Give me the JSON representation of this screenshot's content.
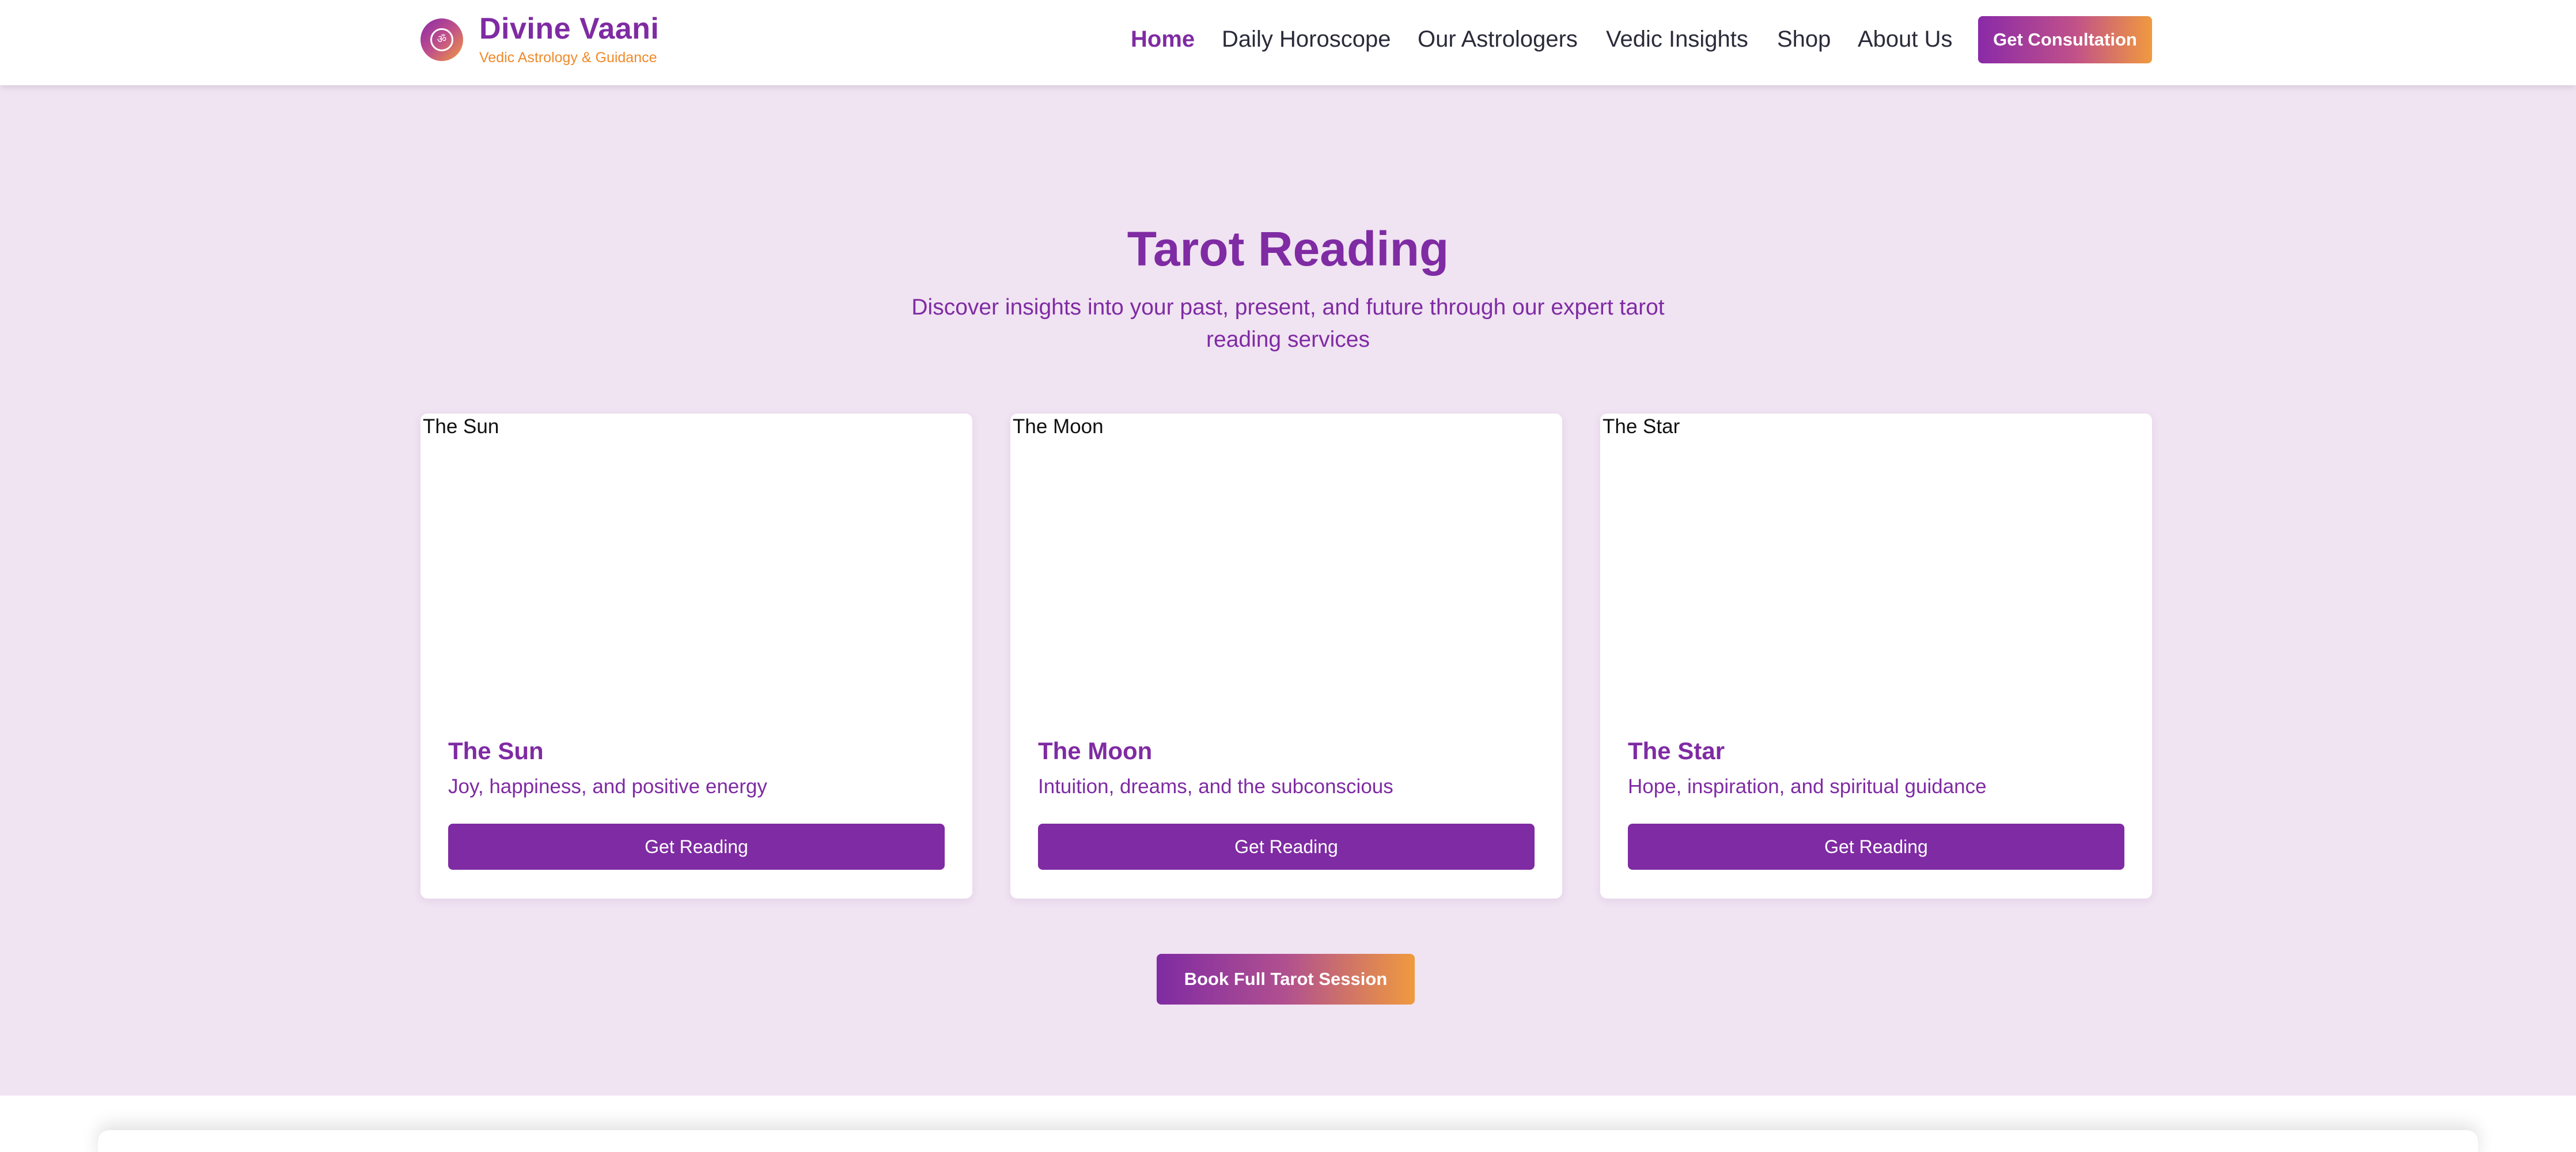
{
  "header": {
    "brand_name": "Divine Vaani",
    "brand_tagline": "Vedic Astrology & Guidance",
    "logo_symbol": "ॐ",
    "logo_icon": "om-icon",
    "nav": [
      {
        "label": "Home",
        "active": true
      },
      {
        "label": "Daily Horoscope",
        "active": false
      },
      {
        "label": "Our Astrologers",
        "active": false
      },
      {
        "label": "Vedic Insights",
        "active": false
      },
      {
        "label": "Shop",
        "active": false
      },
      {
        "label": "About Us",
        "active": false
      }
    ],
    "cta_label": "Get Consultation"
  },
  "tarot": {
    "title": "Tarot Reading",
    "subtitle": "Discover insights into your past, present, and future through our expert tarot reading services",
    "cards": [
      {
        "image_alt": "The Sun",
        "title": "The Sun",
        "description": "Joy, happiness, and positive energy",
        "button_label": "Get Reading"
      },
      {
        "image_alt": "The Moon",
        "title": "The Moon",
        "description": "Intuition, dreams, and the subconscious",
        "button_label": "Get Reading"
      },
      {
        "image_alt": "The Star",
        "title": "The Star",
        "description": "Hope, inspiration, and spiritual guidance",
        "button_label": "Get Reading"
      }
    ],
    "book_label": "Book Full Tarot Session"
  },
  "colors": {
    "brand_purple": "#7f2ba3",
    "accent_orange": "#ee8a2a",
    "section_bg": "#f0e3f2"
  }
}
